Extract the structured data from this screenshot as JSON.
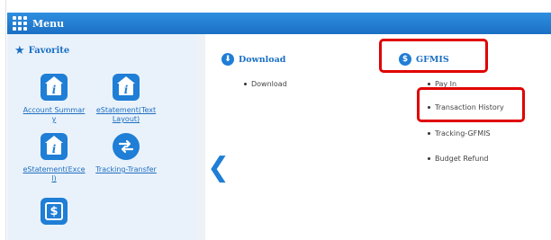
{
  "menu": {
    "title": "Menu"
  },
  "favorite": {
    "label": "Favorite",
    "items": [
      {
        "caption": "Account Summary",
        "icon": "info-house-icon"
      },
      {
        "caption": "eStatement(Text Layout)",
        "icon": "info-house-icon"
      },
      {
        "caption": "eStatement(Excel)",
        "icon": "info-house-icon"
      },
      {
        "caption": "Tracking-Transfer",
        "icon": "transfer-arrows-icon"
      },
      {
        "caption": "",
        "icon": "dollar-icon"
      }
    ]
  },
  "sections": {
    "download": {
      "title": "Download",
      "links": [
        "Download"
      ]
    },
    "gfmis": {
      "title": "GFMIS",
      "links": [
        "Pay In",
        "Transaction History",
        "Tracking-GFMIS",
        "Budget Refund"
      ]
    }
  },
  "colors": {
    "accent": "#1f7ed6",
    "highlight": "#e00000"
  }
}
